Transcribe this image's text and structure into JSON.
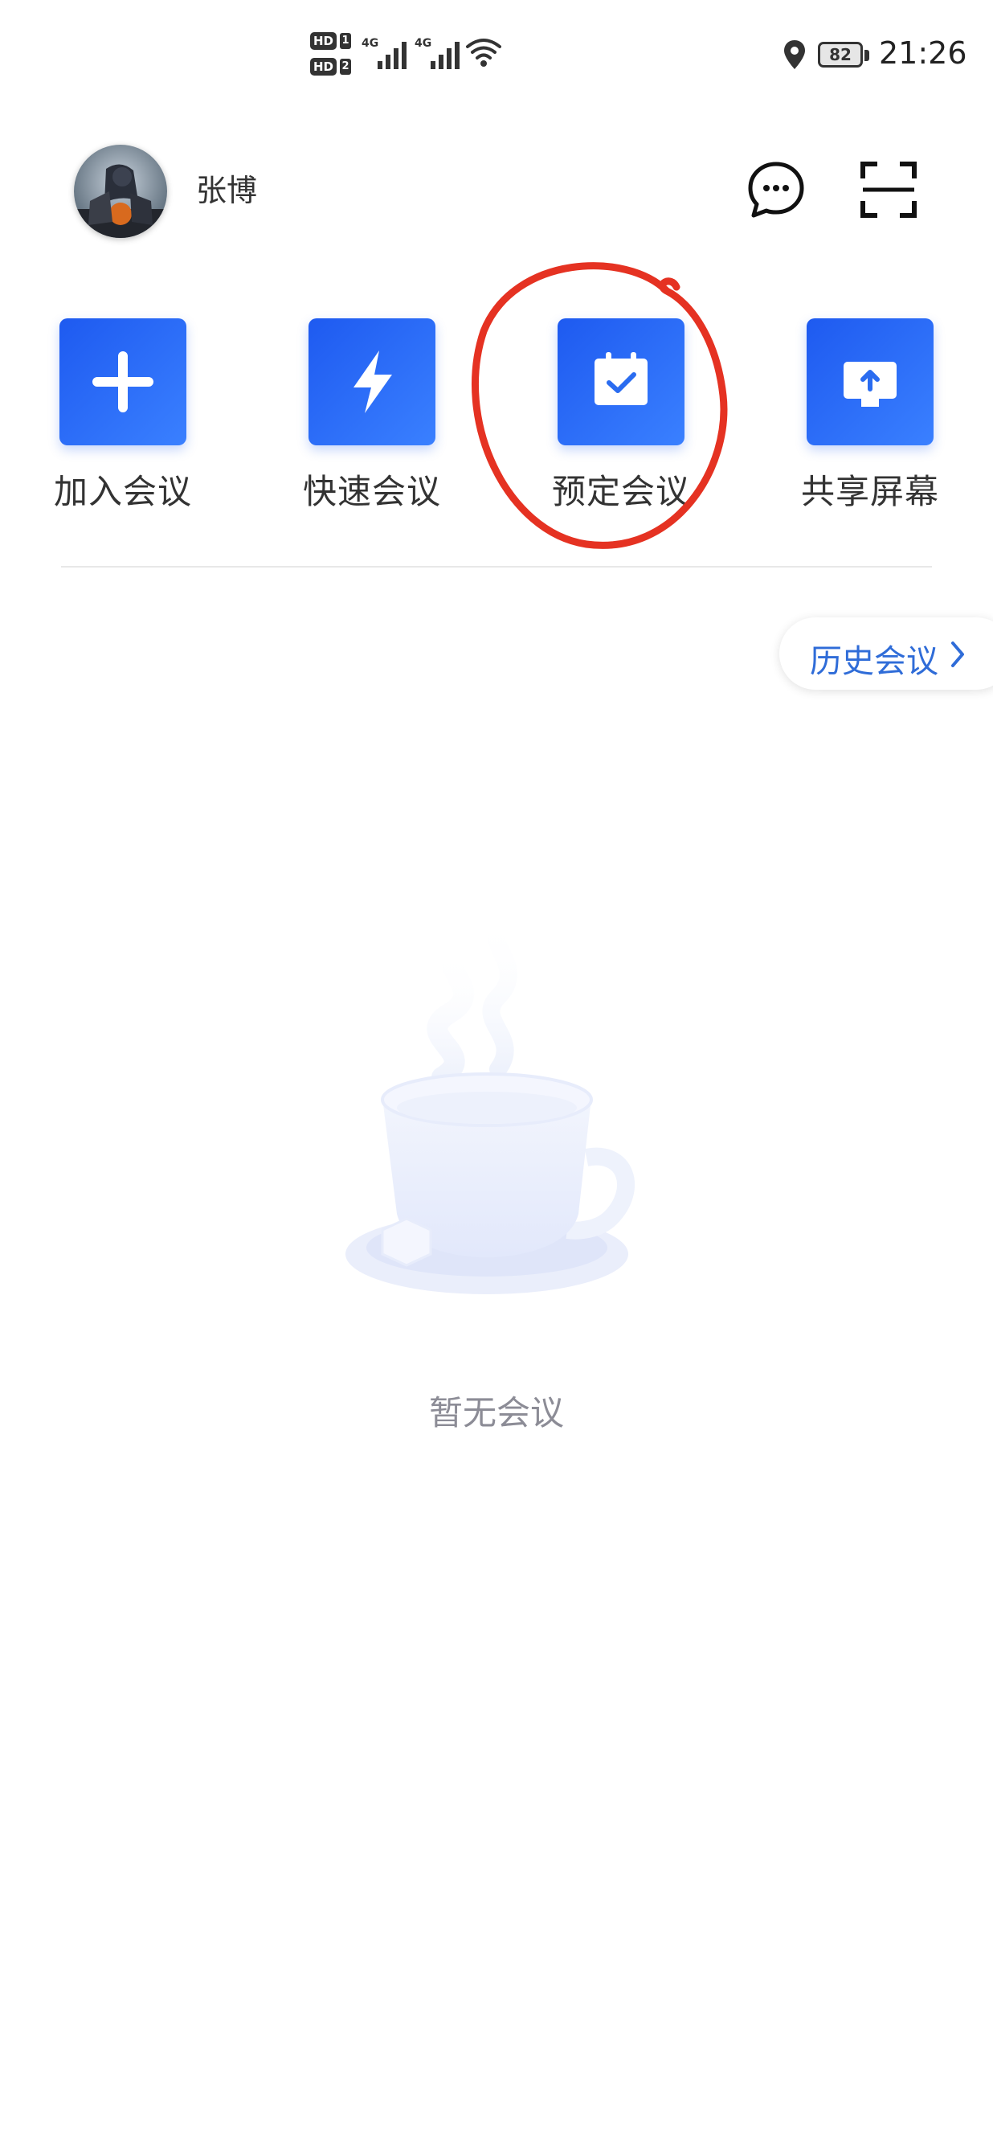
{
  "status_bar": {
    "hd_labels": [
      "HD",
      "HD"
    ],
    "sim_numbers": [
      "1",
      "2"
    ],
    "network": [
      "4G",
      "4G"
    ],
    "battery": "82",
    "time": "21:26"
  },
  "header": {
    "username": "张博"
  },
  "actions": [
    {
      "label": "加入会议",
      "icon": "plus-icon"
    },
    {
      "label": "快速会议",
      "icon": "lightning-icon"
    },
    {
      "label": "预定会议",
      "icon": "calendar-check-icon"
    },
    {
      "label": "共享屏幕",
      "icon": "share-screen-icon"
    }
  ],
  "history": {
    "label": "历史会议"
  },
  "empty": {
    "text": "暂无会议"
  },
  "colors": {
    "accent": "#2f6cd8",
    "tile_gradient_start": "#1e5af0",
    "tile_gradient_end": "#3a80ff",
    "annotation": "#e53222"
  }
}
